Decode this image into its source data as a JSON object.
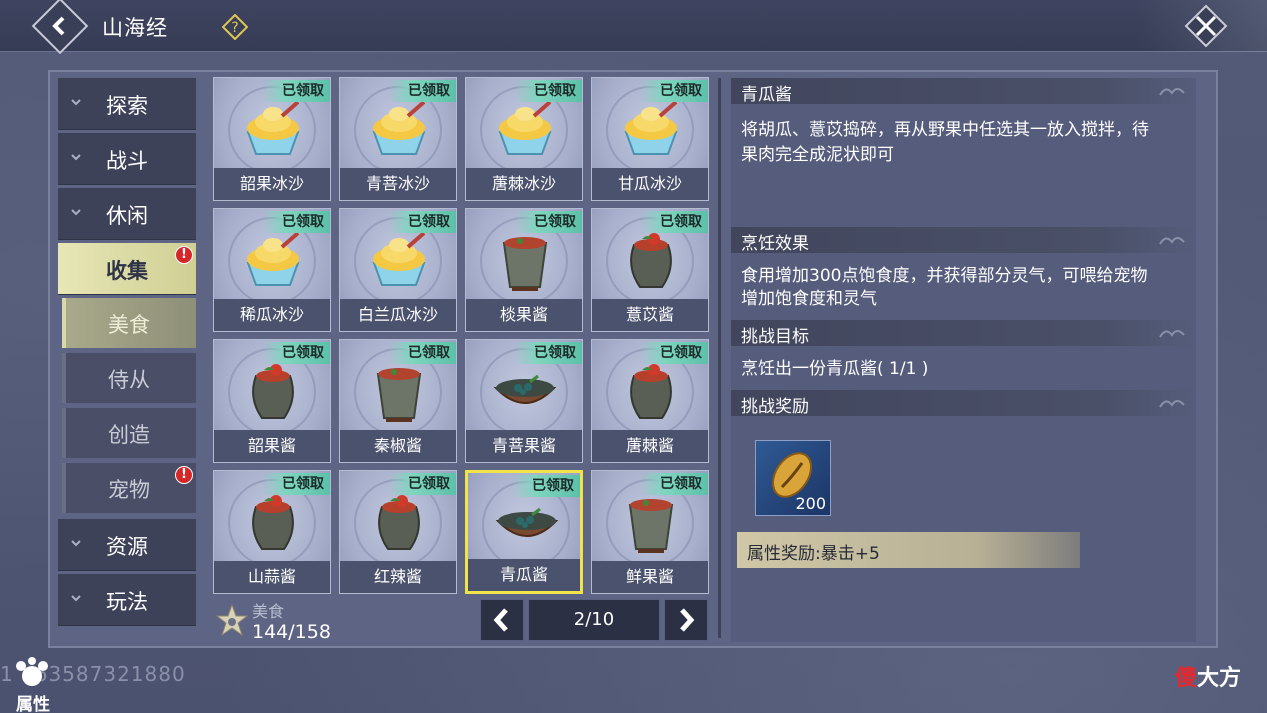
{
  "header": {
    "title": "山海经"
  },
  "sidebar": {
    "items": [
      {
        "label": "探索",
        "expanded": false
      },
      {
        "label": "战斗",
        "expanded": false
      },
      {
        "label": "休闲",
        "expanded": false
      },
      {
        "label": "收集",
        "expanded": true,
        "active": true,
        "alert": "!"
      },
      {
        "label": "资源",
        "expanded": false
      },
      {
        "label": "玩法",
        "expanded": false
      }
    ],
    "sub_items": [
      {
        "label": "美食",
        "active": true
      },
      {
        "label": "侍从"
      },
      {
        "label": "创造"
      },
      {
        "label": "宠物",
        "alert": "!"
      }
    ]
  },
  "grid": {
    "claimed_label": "已领取",
    "cards": [
      {
        "name": "韶果冰沙",
        "icon": "ice-dessert-icon"
      },
      {
        "name": "青菩冰沙",
        "icon": "ice-dessert-icon"
      },
      {
        "name": "蓎棘冰沙",
        "icon": "ice-dessert-icon"
      },
      {
        "name": "甘瓜冰沙",
        "icon": "ice-dessert-icon"
      },
      {
        "name": "稀瓜冰沙",
        "icon": "ice-dessert-icon"
      },
      {
        "name": "白兰瓜冰沙",
        "icon": "ice-dessert-icon"
      },
      {
        "name": "棪果酱",
        "icon": "sauce-cup-icon"
      },
      {
        "name": "薏苡酱",
        "icon": "sauce-jar-icon"
      },
      {
        "name": "韶果酱",
        "icon": "sauce-jar-icon"
      },
      {
        "name": "秦椒酱",
        "icon": "sauce-cup-icon"
      },
      {
        "name": "青菩果酱",
        "icon": "sauce-bowl-icon"
      },
      {
        "name": "蓎棘酱",
        "icon": "sauce-jar-icon"
      },
      {
        "name": "山蒜酱",
        "icon": "sauce-jar-icon"
      },
      {
        "name": "红辣酱",
        "icon": "sauce-jar-icon"
      },
      {
        "name": "青瓜酱",
        "icon": "sauce-bowl-icon",
        "selected": true
      },
      {
        "name": "鲜果酱",
        "icon": "sauce-cup-icon"
      }
    ]
  },
  "collection": {
    "label": "美食",
    "count": "144/158"
  },
  "pagination": {
    "page": "2/10"
  },
  "detail": {
    "title": "青瓜酱",
    "description_line1": "将胡瓜、薏苡捣碎，再从野果中任选其一放入搅拌，待",
    "description_line2": "果肉完全成泥状即可",
    "effect_head": "烹饪效果",
    "effect_line1": "食用增加300点饱食度，并获得部分灵气，可喂给宠物",
    "effect_line2": "增加饱食度和灵气",
    "goal_head": "挑战目标",
    "goal_text": "烹饪出一份青瓜酱( 1/1 )",
    "reward_head": "挑战奖励",
    "reward_item": {
      "icon": "gold-shell-icon",
      "count": "200"
    },
    "attr_reward": "属性奖励:暴击+5"
  },
  "footer": {
    "uid": "1　63587321880",
    "attr_button": "属性",
    "watermark_1": "傻",
    "watermark_2": "大方"
  },
  "colors": {
    "accent_yellow": "#f0e44a",
    "claimed_green": "#7fd6bf",
    "alert_red": "#d6262a"
  }
}
